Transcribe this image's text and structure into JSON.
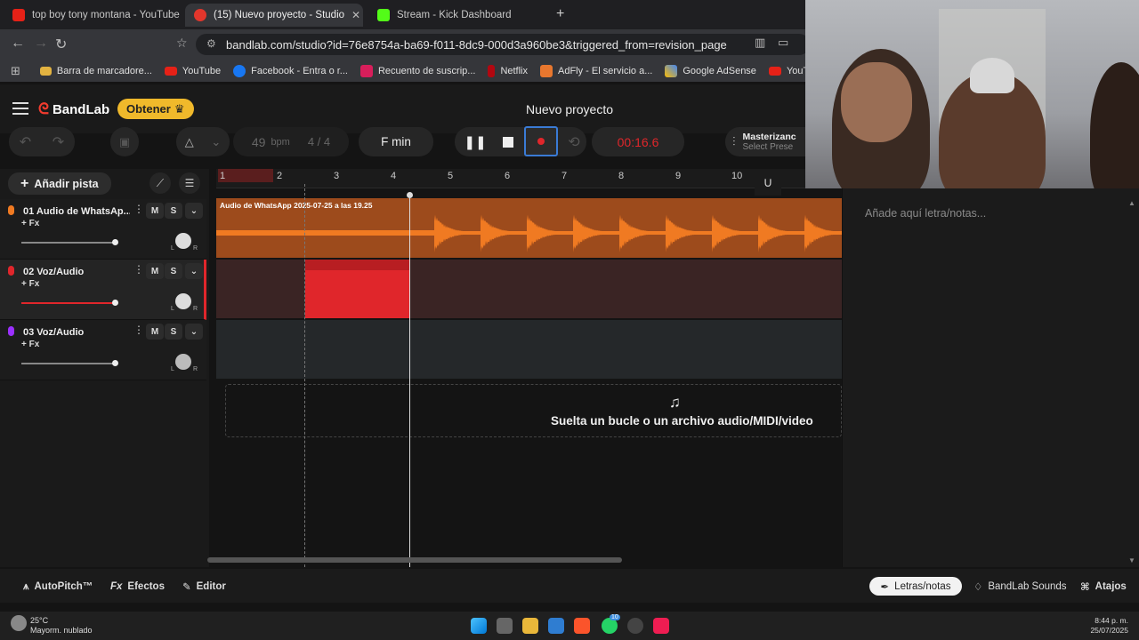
{
  "browser": {
    "tabs": [
      {
        "title": "top boy tony montana - YouTube",
        "active": false
      },
      {
        "title": "(15) Nuevo proyecto - Studio",
        "active": true
      },
      {
        "title": "Stream - Kick Dashboard",
        "active": false
      }
    ],
    "url": "bandlab.com/studio?id=76e8754a-ba69-f011-8dc9-000d3a960be3&triggered_from=revision_page",
    "bookmarks": [
      "Barra de marcadore...",
      "YouTube",
      "Facebook - Entra o r...",
      "Recuento de suscrip...",
      "Netflix",
      "AdFly - El servicio a...",
      "Google AdSense",
      "YouTube Creator St"
    ]
  },
  "app": {
    "logo": "BandLab",
    "obtener_label": "Obtener",
    "project_title": "Nuevo proyecto",
    "bpm_value": "49",
    "bpm_unit": "bpm",
    "time_signature": "4 / 4",
    "key": "F min",
    "timer": "00:16.6",
    "mastering_title": "Masterizanc",
    "mastering_sub": "Select Prese",
    "add_track_label": "Añadir pista"
  },
  "tracks": [
    {
      "name": "01  Audio de WhatsAp...",
      "fx": "+ Fx",
      "mute": "M",
      "solo": "S",
      "pan_l": "L",
      "pan_r": "R"
    },
    {
      "name": "02  Voz/Audio",
      "fx": "+ Fx",
      "mute": "M",
      "solo": "S",
      "pan_l": "L",
      "pan_r": "R"
    },
    {
      "name": "03  Voz/Audio",
      "fx": "+ Fx",
      "mute": "M",
      "solo": "S",
      "pan_l": "L",
      "pan_r": "R"
    }
  ],
  "ruler": [
    "1",
    "2",
    "3",
    "4",
    "5",
    "6",
    "7",
    "8",
    "9",
    "10"
  ],
  "clip_title": "Audio de WhatsApp 2025-07-25 a las 19.25",
  "dropzone_text": "Suelta un bucle o un archivo audio/MIDI/video",
  "lyrics_placeholder": "Añade aquí letra/notas...",
  "lyrics_header": "Letras/notas",
  "bottom": {
    "autopitch": "AutoPitch™",
    "efectos": "Efectos",
    "editor": "Editor",
    "letras": "Letras/notas",
    "sounds": "BandLab Sounds",
    "atajos": "Atajos"
  },
  "taskbar": {
    "weather_temp": "25°C",
    "weather_desc": "Mayorm. nublado",
    "time": "8:44 p. m.",
    "date": "25/07/2025",
    "whatsapp_badge": "10"
  },
  "colors": {
    "accent_orange": "#f07a22",
    "record_red": "#e0262b",
    "obtener_yellow": "#f0b92b"
  }
}
